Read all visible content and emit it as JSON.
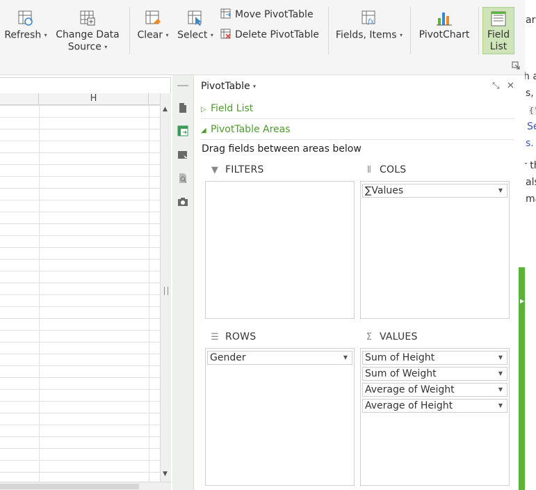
{
  "ribbon": {
    "refresh": "Refresh",
    "change_data_source_line1": "Change Data",
    "change_data_source_line2": "Source",
    "clear": "Clear",
    "select": "Select",
    "move_pivot": "Move PivotTable",
    "delete_pivot": "Delete PivotTable",
    "fields_items": "Fields, Items",
    "pivot_chart": "PivotChart",
    "field_list_line1": "Field",
    "field_list_line2": "List"
  },
  "grid": {
    "column_header": "H"
  },
  "panel": {
    "title": "PivotTable",
    "field_list_section": "Field List",
    "areas_section": "PivotTable Areas",
    "drag_hint": "Drag fields between areas below",
    "filters_label": "FILTERS",
    "cols_label": "COLS",
    "rows_label": "ROWS",
    "values_label": "VALUES",
    "cols_fields": [
      "∑Values"
    ],
    "rows_fields": [
      "Gender"
    ],
    "values_fields": [
      "Sum of Height",
      "Sum of Weight",
      "Average of Weight",
      "Average of Height"
    ]
  },
  "edge_text": {
    "line1": "ar",
    "line2": "h a",
    "line3": "s,",
    "line4": "{'",
    "line5": "Se",
    "line6": "s.",
    "line7": "r th",
    "line8": "als",
    "line9": "ma"
  },
  "colors": {
    "accent_green": "#4f9a2d",
    "active_button": "#cfe4b8",
    "splitter": "#5cb33c"
  }
}
